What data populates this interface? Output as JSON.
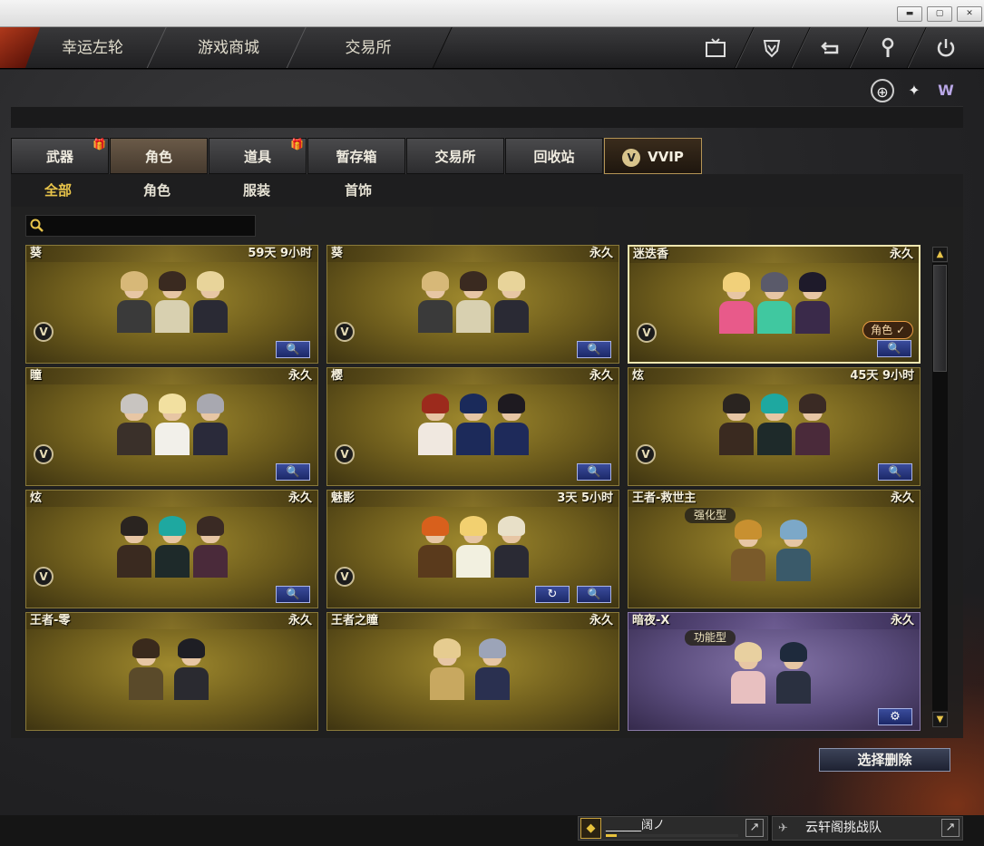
{
  "window": {
    "min": "▬",
    "restore": "▢",
    "close": "✕"
  },
  "topnav": {
    "tabs": [
      "幸运左轮",
      "游戏商城",
      "交易所"
    ],
    "icons": [
      "tv-icon",
      "shield-icon",
      "return-icon",
      "wrench-icon",
      "power-icon"
    ]
  },
  "util_icons": [
    "target-icon",
    "spark-icon",
    "vvip-w-icon"
  ],
  "tabs": {
    "items": [
      {
        "label": "武器",
        "gift": true
      },
      {
        "label": "角色",
        "gift": false
      },
      {
        "label": "道具",
        "gift": true
      },
      {
        "label": "暂存箱",
        "gift": false
      },
      {
        "label": "交易所",
        "gift": false
      },
      {
        "label": "回收站",
        "gift": false
      },
      {
        "label": "VVIP",
        "gift": false
      }
    ],
    "active": "角色",
    "gift_glyph": "🎁"
  },
  "subtabs": {
    "items": [
      "全部",
      "角色",
      "服装",
      "首饰"
    ],
    "active": "全部"
  },
  "search": {
    "value": "",
    "placeholder": ""
  },
  "cards": [
    {
      "name": "葵",
      "time": "59天 9小时",
      "vip": true
    },
    {
      "name": "葵",
      "time": "永久",
      "vip": true
    },
    {
      "name": "迷迭香",
      "time": "永久",
      "vip": true,
      "selected": true,
      "role_badge": "角色 ✓"
    },
    {
      "name": "瞳",
      "time": "永久",
      "vip": true
    },
    {
      "name": "樱",
      "time": "永久",
      "vip": true
    },
    {
      "name": "炫",
      "time": "45天 9小时",
      "vip": true
    },
    {
      "name": "炫",
      "time": "永久",
      "vip": true
    },
    {
      "name": "魅影",
      "time": "3天 5小时",
      "vip": true,
      "refresh": true
    },
    {
      "name": "王者-救世主",
      "time": "永久",
      "vip": false,
      "type_badge": "强化型"
    },
    {
      "name": "王者-零",
      "time": "永久",
      "vip": false
    },
    {
      "name": "王者之瞳",
      "time": "永久",
      "vip": false
    },
    {
      "name": "暗夜-X",
      "time": "永久",
      "vip": false,
      "type_badge": "功能型",
      "purple": true,
      "gear": true
    }
  ],
  "delete_button": "选择删除",
  "player": {
    "name": "______阔ノ",
    "progress": 0.08
  },
  "clan": {
    "name": "云轩阁挑战队"
  },
  "glyphs": {
    "search": "🔍",
    "v": "V",
    "refresh": "↻",
    "gear": "⚙",
    "ext": "↗",
    "up": "▲",
    "down": "▼"
  }
}
